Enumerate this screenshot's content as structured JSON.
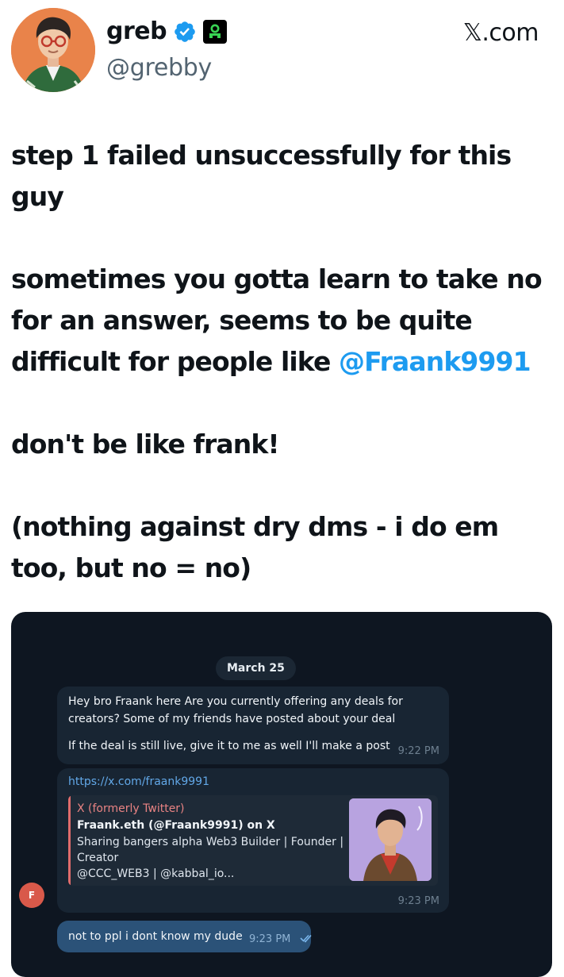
{
  "tweet": {
    "author": {
      "name": "greb",
      "handle": "@grebby"
    },
    "site": "𝕏.com",
    "paragraphs": [
      {
        "text": "step 1 failed unsuccessfully for this guy"
      },
      {
        "text": "sometimes you gotta learn to take no for an answer, seems to be quite difficult for people like ",
        "mention": "@Fraank9991"
      },
      {
        "text": "don't be like frank!"
      },
      {
        "text": "(nothing against dry dms - i do em too, but no = no)"
      }
    ]
  },
  "chat": {
    "date": "March 25",
    "messages": [
      {
        "line1": "Hey bro Fraank here Are you currently offering any deals for",
        "line2": "creators? Some of my friends have posted about your deal",
        "line3": "If the deal is still live, give it to me as well I'll make a post",
        "time": "9:22 PM"
      },
      {
        "link": "https://x.com/fraank9991",
        "preview": {
          "site": "X (formerly Twitter)",
          "title": "Fraank.eth (@Fraank9991) on X",
          "desc1": "Sharing bangers alpha Web3 Builder | Founder |",
          "desc2": "Creator",
          "desc3": "@CCC_WEB3 | @kabbal_io..."
        },
        "time": "9:23 PM"
      },
      {
        "text": "not to ppl i dont know my dude",
        "time": "9:23 PM"
      }
    ],
    "sender_initial": "F"
  },
  "colors": {
    "link_blue": "#1d9bf0",
    "verified_blue": "#1d9bf0",
    "chat_bg": "#0e1621",
    "incoming_bubble": "#182533",
    "outgoing_bubble": "#2b5278",
    "badge_green": "#39d353"
  },
  "icons": {
    "verified": "verified-check-icon",
    "badge": "green-glyph-icon",
    "read": "double-check-icon"
  }
}
